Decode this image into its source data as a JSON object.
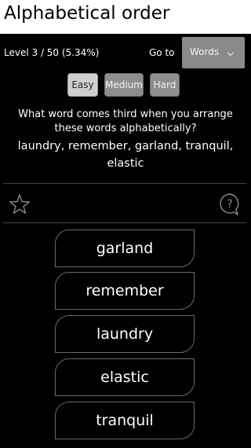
{
  "header": {
    "title": "Alphabetical order"
  },
  "level": {
    "text": "Level 3 / 50 (5.34%)",
    "goto_label": "Go to",
    "goto_selected": "Words"
  },
  "difficulty": {
    "easy": "Easy",
    "medium": "Medium",
    "hard": "Hard",
    "selected": "Easy"
  },
  "question": {
    "prompt": "What word comes third when you arrange these words alphabetically?",
    "words": "laundry, remember, garland, tranquil, elastic"
  },
  "icons": {
    "favorite": "star-icon",
    "help": "help-icon"
  },
  "answers": [
    "garland",
    "remember",
    "laundry",
    "elastic",
    "tranquil"
  ],
  "colors": {
    "header_bg": "#ffffff",
    "background": "#000000",
    "selected_pill": "#cfcfcf",
    "pill": "#8e8e8e"
  }
}
